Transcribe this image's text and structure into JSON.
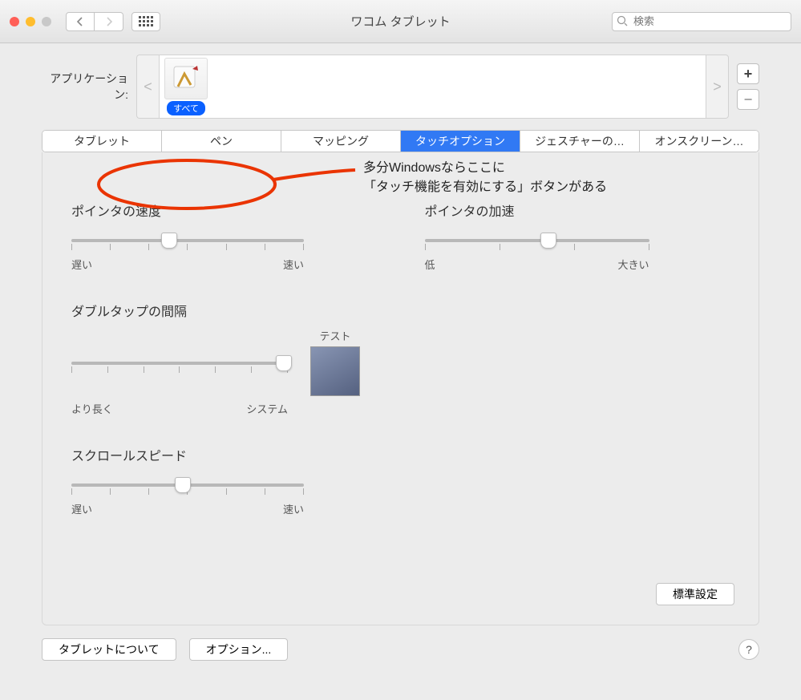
{
  "window": {
    "title": "ワコム タブレット"
  },
  "search": {
    "placeholder": "検索"
  },
  "applications": {
    "label": "アプリケーション:",
    "items": [
      {
        "badge": "すべて"
      }
    ]
  },
  "tabs": [
    {
      "label": "タブレット"
    },
    {
      "label": "ペン"
    },
    {
      "label": "マッピング"
    },
    {
      "label": "タッチオプション",
      "active": true
    },
    {
      "label": "ジェスチャーの…"
    },
    {
      "label": "オンスクリーン…"
    }
  ],
  "annotation": {
    "line1": "多分Windowsならここに",
    "line2": "「タッチ機能を有効にする」ボタンがある"
  },
  "sliders": {
    "pointerSpeed": {
      "title": "ポインタの速度",
      "left": "遅い",
      "right": "速い",
      "position": 42
    },
    "pointerAccel": {
      "title": "ポインタの加速",
      "left": "低",
      "right": "大きい",
      "position": 55
    },
    "doubleTap": {
      "title": "ダブルタップの間隔",
      "left": "より長く",
      "right": "システム",
      "test": "テスト",
      "position": 98
    },
    "scrollSpeed": {
      "title": "スクロールスピード",
      "left": "遅い",
      "right": "速い",
      "position": 48
    }
  },
  "buttons": {
    "defaults": "標準設定",
    "about": "タブレットについて",
    "options": "オプション...",
    "add": "+",
    "remove": "−",
    "help": "?"
  }
}
